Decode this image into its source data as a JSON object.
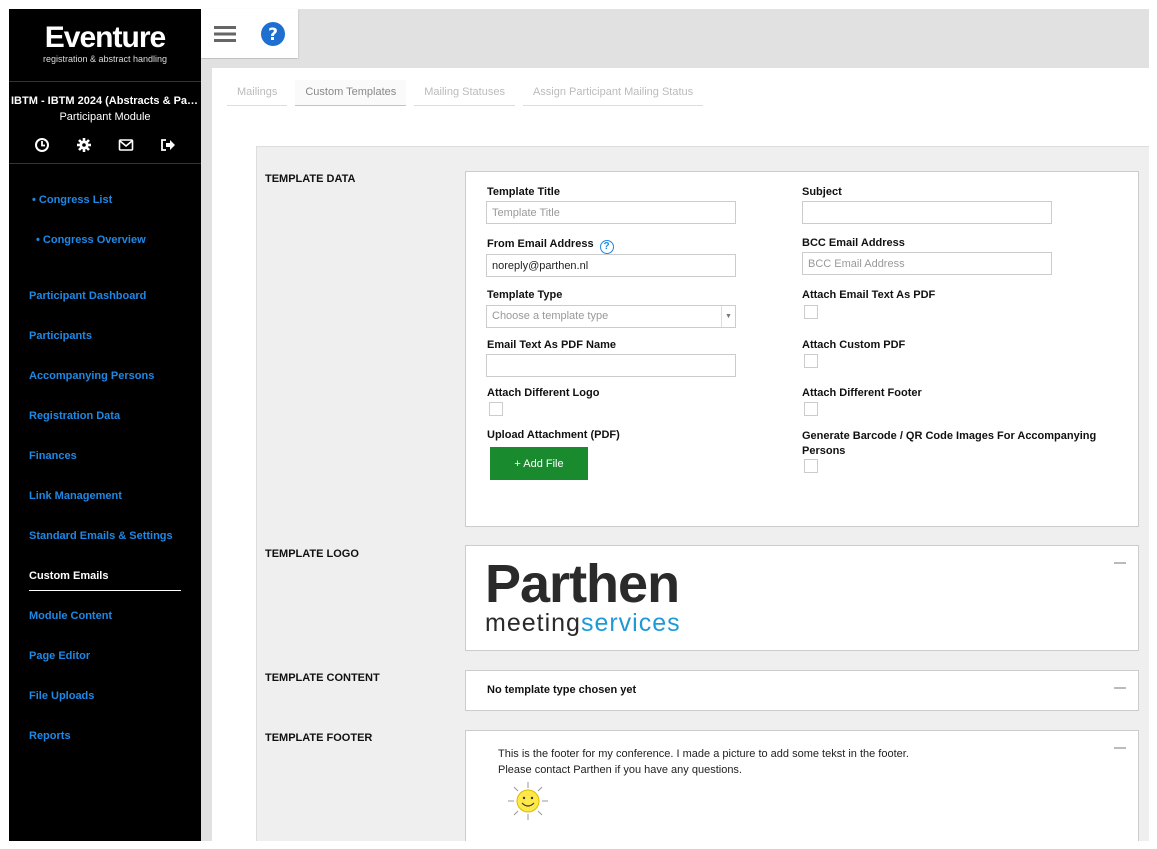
{
  "brand": {
    "name": "Eventure",
    "tagline": "registration & abstract handling"
  },
  "congress": {
    "title": "IBTM - IBTM 2024 (Abstracts & Par...",
    "module": "Participant Module"
  },
  "quick_icons": [
    "history-icon",
    "gear-icon",
    "mail-icon",
    "logout-icon"
  ],
  "sidebar": {
    "top_items": [
      {
        "label": "• Congress List"
      },
      {
        "label": "• Congress Overview"
      }
    ],
    "items": [
      {
        "label": "Participant Dashboard"
      },
      {
        "label": "Participants"
      },
      {
        "label": "Accompanying Persons"
      },
      {
        "label": "Registration Data"
      },
      {
        "label": "Finances"
      },
      {
        "label": "Link Management"
      },
      {
        "label": "Standard Emails & Settings"
      },
      {
        "label": "Custom Emails"
      },
      {
        "label": "Module Content"
      },
      {
        "label": "Page Editor"
      },
      {
        "label": "File Uploads"
      },
      {
        "label": "Reports"
      }
    ],
    "active": "Custom Emails"
  },
  "tabs": [
    {
      "label": "Mailings"
    },
    {
      "label": "Custom Templates"
    },
    {
      "label": "Mailing Statuses"
    },
    {
      "label": "Assign Participant Mailing Status"
    }
  ],
  "sections": {
    "data": "TEMPLATE DATA",
    "logo": "TEMPLATE LOGO",
    "content": "TEMPLATE CONTENT",
    "footer": "TEMPLATE FOOTER"
  },
  "form": {
    "template_title": {
      "label": "Template Title",
      "placeholder": "Template Title",
      "value": ""
    },
    "subject": {
      "label": "Subject",
      "value": ""
    },
    "from_email": {
      "label": "From Email Address",
      "value": "noreply@parthen.nl"
    },
    "bcc_email": {
      "label": "BCC Email Address",
      "placeholder": "BCC Email Address"
    },
    "template_type": {
      "label": "Template Type",
      "placeholder": "Choose a template type"
    },
    "attach_text_pdf": {
      "label": "Attach Email Text As PDF",
      "checked": false
    },
    "pdf_name": {
      "label": "Email Text As PDF Name",
      "value": ""
    },
    "attach_custom_pdf": {
      "label": "Attach Custom PDF",
      "checked": false
    },
    "attach_logo": {
      "label": "Attach Different Logo",
      "checked": false
    },
    "attach_footer": {
      "label": "Attach Different Footer",
      "checked": false
    },
    "upload": {
      "label": "Upload Attachment (PDF)",
      "button": "+ Add File"
    },
    "barcode": {
      "label": "Generate Barcode / QR Code Images For Accompanying Persons",
      "checked": false
    }
  },
  "logo": {
    "line1": "Parthen",
    "line2a": "meeting",
    "line2b": "services",
    "accent_color": "#1e9ad6"
  },
  "content_text": "No template type chosen yet",
  "footer": {
    "line1": "This is the footer for my conference. I made a picture to add some tekst in the footer.",
    "line2": "Please contact Parthen if you have any questions."
  },
  "colors": {
    "accent": "#1e88e5",
    "sidebar": "#000000",
    "button": "#1a8a2f"
  }
}
